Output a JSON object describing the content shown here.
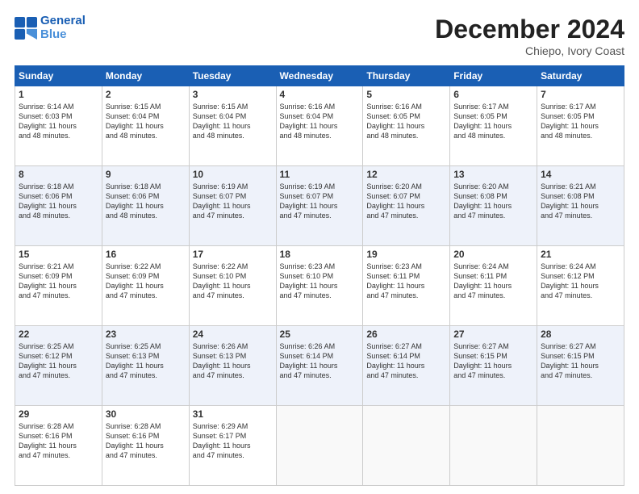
{
  "header": {
    "logo_line1": "General",
    "logo_line2": "Blue",
    "month_title": "December 2024",
    "subtitle": "Chiepo, Ivory Coast"
  },
  "weekdays": [
    "Sunday",
    "Monday",
    "Tuesday",
    "Wednesday",
    "Thursday",
    "Friday",
    "Saturday"
  ],
  "weeks": [
    [
      {
        "day": "1",
        "text": "Sunrise: 6:14 AM\nSunset: 6:03 PM\nDaylight: 11 hours\nand 48 minutes."
      },
      {
        "day": "2",
        "text": "Sunrise: 6:15 AM\nSunset: 6:04 PM\nDaylight: 11 hours\nand 48 minutes."
      },
      {
        "day": "3",
        "text": "Sunrise: 6:15 AM\nSunset: 6:04 PM\nDaylight: 11 hours\nand 48 minutes."
      },
      {
        "day": "4",
        "text": "Sunrise: 6:16 AM\nSunset: 6:04 PM\nDaylight: 11 hours\nand 48 minutes."
      },
      {
        "day": "5",
        "text": "Sunrise: 6:16 AM\nSunset: 6:05 PM\nDaylight: 11 hours\nand 48 minutes."
      },
      {
        "day": "6",
        "text": "Sunrise: 6:17 AM\nSunset: 6:05 PM\nDaylight: 11 hours\nand 48 minutes."
      },
      {
        "day": "7",
        "text": "Sunrise: 6:17 AM\nSunset: 6:05 PM\nDaylight: 11 hours\nand 48 minutes."
      }
    ],
    [
      {
        "day": "8",
        "text": "Sunrise: 6:18 AM\nSunset: 6:06 PM\nDaylight: 11 hours\nand 48 minutes."
      },
      {
        "day": "9",
        "text": "Sunrise: 6:18 AM\nSunset: 6:06 PM\nDaylight: 11 hours\nand 48 minutes."
      },
      {
        "day": "10",
        "text": "Sunrise: 6:19 AM\nSunset: 6:07 PM\nDaylight: 11 hours\nand 47 minutes."
      },
      {
        "day": "11",
        "text": "Sunrise: 6:19 AM\nSunset: 6:07 PM\nDaylight: 11 hours\nand 47 minutes."
      },
      {
        "day": "12",
        "text": "Sunrise: 6:20 AM\nSunset: 6:07 PM\nDaylight: 11 hours\nand 47 minutes."
      },
      {
        "day": "13",
        "text": "Sunrise: 6:20 AM\nSunset: 6:08 PM\nDaylight: 11 hours\nand 47 minutes."
      },
      {
        "day": "14",
        "text": "Sunrise: 6:21 AM\nSunset: 6:08 PM\nDaylight: 11 hours\nand 47 minutes."
      }
    ],
    [
      {
        "day": "15",
        "text": "Sunrise: 6:21 AM\nSunset: 6:09 PM\nDaylight: 11 hours\nand 47 minutes."
      },
      {
        "day": "16",
        "text": "Sunrise: 6:22 AM\nSunset: 6:09 PM\nDaylight: 11 hours\nand 47 minutes."
      },
      {
        "day": "17",
        "text": "Sunrise: 6:22 AM\nSunset: 6:10 PM\nDaylight: 11 hours\nand 47 minutes."
      },
      {
        "day": "18",
        "text": "Sunrise: 6:23 AM\nSunset: 6:10 PM\nDaylight: 11 hours\nand 47 minutes."
      },
      {
        "day": "19",
        "text": "Sunrise: 6:23 AM\nSunset: 6:11 PM\nDaylight: 11 hours\nand 47 minutes."
      },
      {
        "day": "20",
        "text": "Sunrise: 6:24 AM\nSunset: 6:11 PM\nDaylight: 11 hours\nand 47 minutes."
      },
      {
        "day": "21",
        "text": "Sunrise: 6:24 AM\nSunset: 6:12 PM\nDaylight: 11 hours\nand 47 minutes."
      }
    ],
    [
      {
        "day": "22",
        "text": "Sunrise: 6:25 AM\nSunset: 6:12 PM\nDaylight: 11 hours\nand 47 minutes."
      },
      {
        "day": "23",
        "text": "Sunrise: 6:25 AM\nSunset: 6:13 PM\nDaylight: 11 hours\nand 47 minutes."
      },
      {
        "day": "24",
        "text": "Sunrise: 6:26 AM\nSunset: 6:13 PM\nDaylight: 11 hours\nand 47 minutes."
      },
      {
        "day": "25",
        "text": "Sunrise: 6:26 AM\nSunset: 6:14 PM\nDaylight: 11 hours\nand 47 minutes."
      },
      {
        "day": "26",
        "text": "Sunrise: 6:27 AM\nSunset: 6:14 PM\nDaylight: 11 hours\nand 47 minutes."
      },
      {
        "day": "27",
        "text": "Sunrise: 6:27 AM\nSunset: 6:15 PM\nDaylight: 11 hours\nand 47 minutes."
      },
      {
        "day": "28",
        "text": "Sunrise: 6:27 AM\nSunset: 6:15 PM\nDaylight: 11 hours\nand 47 minutes."
      }
    ],
    [
      {
        "day": "29",
        "text": "Sunrise: 6:28 AM\nSunset: 6:16 PM\nDaylight: 11 hours\nand 47 minutes."
      },
      {
        "day": "30",
        "text": "Sunrise: 6:28 AM\nSunset: 6:16 PM\nDaylight: 11 hours\nand 47 minutes."
      },
      {
        "day": "31",
        "text": "Sunrise: 6:29 AM\nSunset: 6:17 PM\nDaylight: 11 hours\nand 47 minutes."
      },
      null,
      null,
      null,
      null
    ]
  ]
}
